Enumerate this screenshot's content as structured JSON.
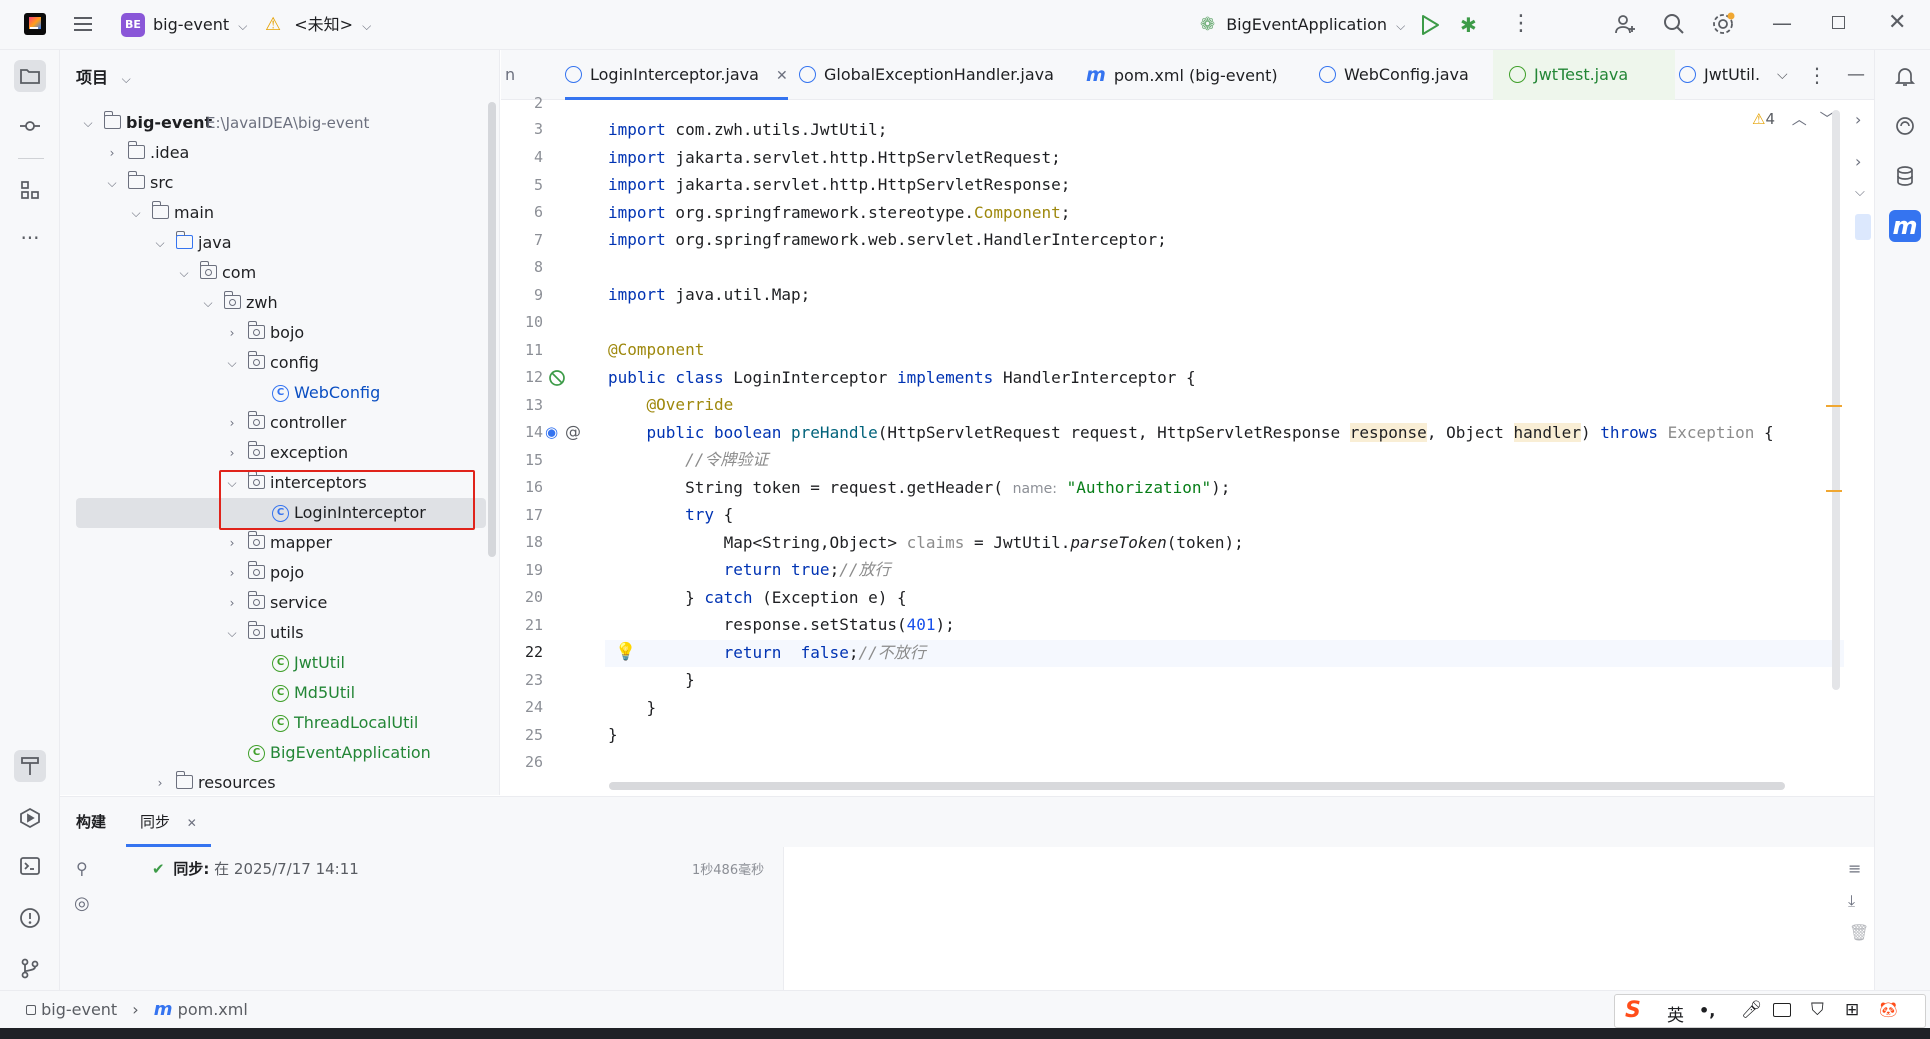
{
  "topbar": {
    "project_badge": "BE",
    "project_name": "big-event",
    "vcs_status": "<未知>",
    "run_config": "BigEventApplication"
  },
  "project_panel": {
    "title": "项目",
    "root_name": "big-event",
    "root_path": "E:\\JavaIDEA\\big-event",
    "items": [
      {
        "label": "big-event"
      },
      {
        "label": ".idea"
      },
      {
        "label": "src"
      },
      {
        "label": "main"
      },
      {
        "label": "java"
      },
      {
        "label": "com"
      },
      {
        "label": "zwh"
      },
      {
        "label": "bojo"
      },
      {
        "label": "config"
      },
      {
        "label": "WebConfig"
      },
      {
        "label": "controller"
      },
      {
        "label": "exception"
      },
      {
        "label": "interceptors"
      },
      {
        "label": "LoginInterceptor"
      },
      {
        "label": "mapper"
      },
      {
        "label": "pojo"
      },
      {
        "label": "service"
      },
      {
        "label": "utils"
      },
      {
        "label": "JwtUtil"
      },
      {
        "label": "Md5Util"
      },
      {
        "label": "ThreadLocalUtil"
      },
      {
        "label": "BigEventApplication"
      },
      {
        "label": "resources"
      }
    ]
  },
  "editor_tabs": {
    "t0": "LoginInterceptor.java",
    "t1": "GlobalExceptionHandler.java",
    "t2": "pom.xml (big-event)",
    "t3": "WebConfig.java",
    "t4": "JwtTest.java",
    "t5": "JwtUtil.",
    "left_fragment": "n"
  },
  "editor": {
    "warning_count": "4",
    "line_numbers": [
      "2",
      "3",
      "4",
      "5",
      "6",
      "7",
      "8",
      "9",
      "10",
      "11",
      "12",
      "13",
      "14",
      "15",
      "16",
      "17",
      "18",
      "19",
      "20",
      "21",
      "22",
      "23",
      "24",
      "25",
      "26"
    ],
    "current_line": "22"
  },
  "bottom_panel": {
    "tab_build": "构建",
    "tab_sync": "同步",
    "sync_label": "同步:",
    "sync_time": "在 2025/7/17 14:11",
    "sync_duration": "1秒486毫秒"
  },
  "statusbar": {
    "crumb_project": "big-event",
    "crumb_file": "pom.xml"
  },
  "ime": {
    "lang": "英",
    "punct": "•,"
  },
  "colors": {
    "accent": "#3574f0",
    "highlight_box": "#e0231b",
    "keyword": "#0033b3",
    "annotation": "#9e880d",
    "string": "#067d17"
  }
}
